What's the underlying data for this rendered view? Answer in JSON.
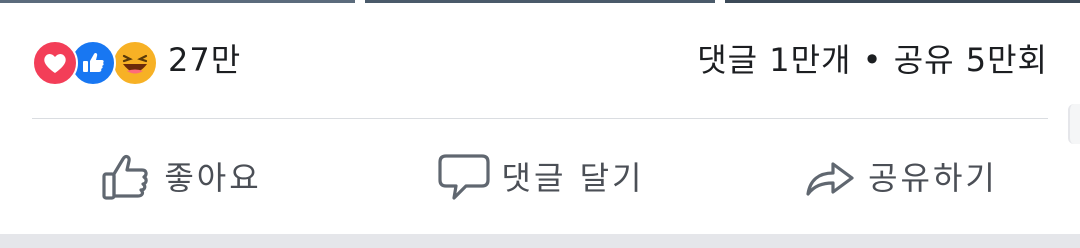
{
  "reactions": {
    "icons": [
      "heart-icon",
      "like-icon",
      "haha-icon"
    ],
    "count": "27만"
  },
  "stats": {
    "text": "댓글 1만개 • 공유 5만회"
  },
  "actions": {
    "like": "좋아요",
    "comment": "댓글 달기",
    "share": "공유하기"
  },
  "colors": {
    "love": "#f33e58",
    "like": "#1877f2",
    "haha": "#f7b125",
    "action_text": "#4b4f56",
    "divider": "#dadde1"
  }
}
